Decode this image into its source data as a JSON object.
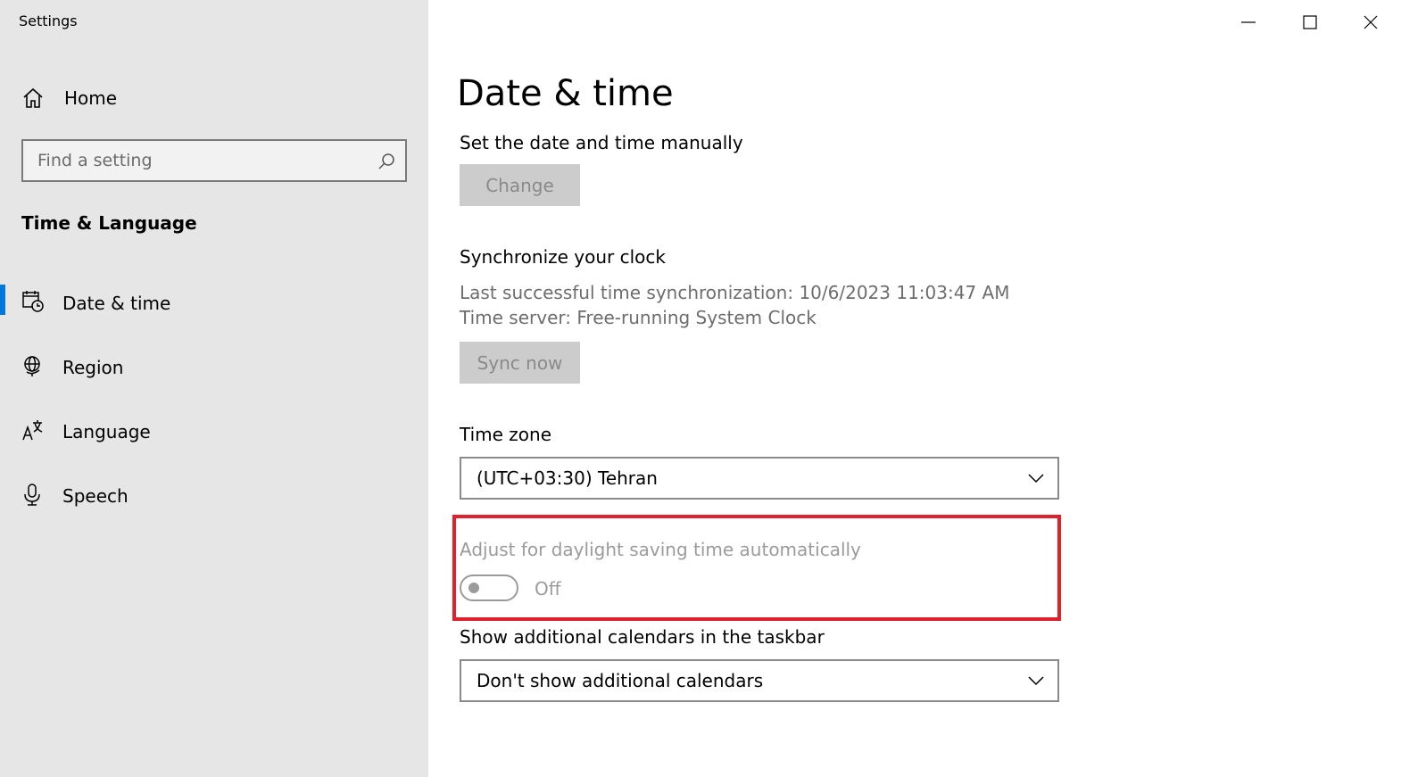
{
  "window": {
    "title": "Settings",
    "controls": {
      "minimize": "minimize",
      "maximize": "maximize",
      "close": "close"
    }
  },
  "sidebar": {
    "home_label": "Home",
    "search_placeholder": "Find a setting",
    "section_title": "Time & Language",
    "items": [
      {
        "label": "Date & time",
        "icon": "calendar-clock-icon",
        "selected": true
      },
      {
        "label": "Region",
        "icon": "globe-icon",
        "selected": false
      },
      {
        "label": "Language",
        "icon": "language-icon",
        "selected": false
      },
      {
        "label": "Speech",
        "icon": "microphone-icon",
        "selected": false
      }
    ],
    "accent_color": "#0078d7"
  },
  "main": {
    "page_title": "Date & time",
    "set_manually_label": "Set the date and time manually",
    "change_button": "Change",
    "sync_heading": "Synchronize your clock",
    "last_sync": "Last successful time synchronization: 10/6/2023 11:03:47 AM",
    "time_server": "Time server: Free-running System Clock",
    "sync_button": "Sync now",
    "timezone_label": "Time zone",
    "timezone_value": "(UTC+03:30) Tehran",
    "dst_label": "Adjust for daylight saving time automatically",
    "dst_toggle_state": "Off",
    "dst_toggle_on": false,
    "calendars_label": "Show additional calendars in the taskbar",
    "calendars_value": "Don't show additional calendars",
    "highlight_color": "#e0202b"
  }
}
